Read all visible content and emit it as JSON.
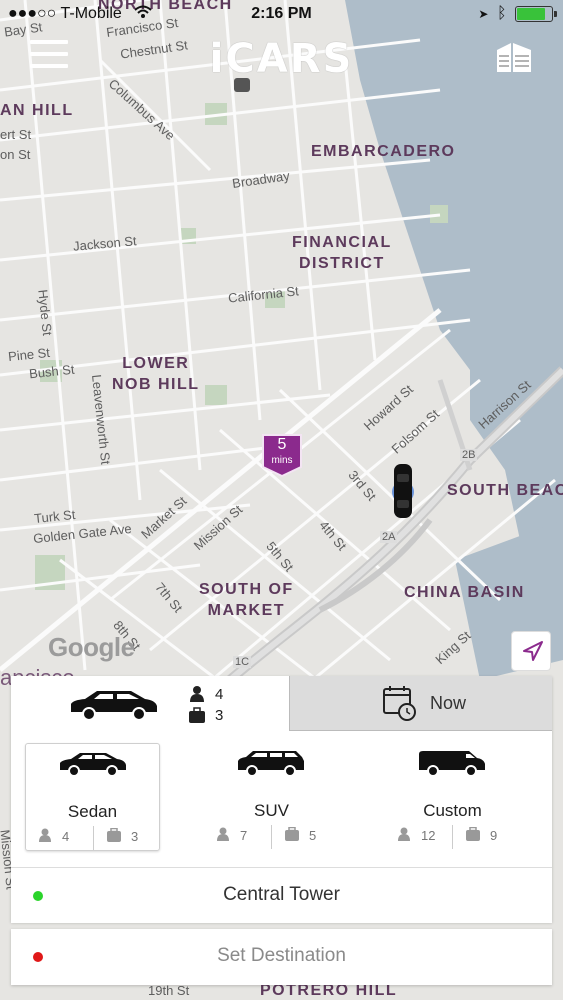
{
  "status_bar": {
    "carrier": "●●●○○ T-Mobile",
    "time": "2:16 PM",
    "battery_color": "#39c23a"
  },
  "header": {
    "logo": "iCARS",
    "menu_icon": "hamburger-icon",
    "building_icon": "building-icon"
  },
  "map": {
    "areas": {
      "north_beach": "NORTH BEACH",
      "russian_hill": "AN HILL",
      "embarcadero": "EMBARCADERO",
      "financial_district": "FINANCIAL\nDISTRICT",
      "lower_nob_hill": "LOWER\nNOB HILL",
      "south_beach": "SOUTH BEAC",
      "south_of_market": "SOUTH OF\nMARKET",
      "china_basin": "CHINA BASIN",
      "potrero_hill": "POTRERO HILL"
    },
    "streets": {
      "bay": "Bay St",
      "francisco": "Francisco St",
      "chestnut": "Chestnut St",
      "columbus": "Columbus Ave",
      "broadway": "Broadway",
      "jackson": "Jackson St",
      "california": "California St",
      "hyde": "Hyde St",
      "pine": "Pine St",
      "bush": "Bush St",
      "leavenworth": "Leavenworth St",
      "turk": "Turk St",
      "golden_gate": "Golden Gate Ave",
      "market": "Market St",
      "mission": "Mission St",
      "howard": "Howard St",
      "folsom": "Folsom St",
      "harrison": "Harrison St",
      "third": "3rd St",
      "fourth": "4th St",
      "fifth": "5th St",
      "seventh": "7th St",
      "eighth": "8th St",
      "king": "King St",
      "nineteenth": "19th St",
      "mission_left": "Mission St",
      "ert": "ert St",
      "on": "on St",
      "francisco_left": "ancisco"
    },
    "highway_labels": {
      "b2b": "2B",
      "b2a": "2A",
      "b1c": "1C"
    },
    "eta": {
      "value": "5",
      "unit": "mins"
    },
    "google": "Google"
  },
  "panel": {
    "tab_vehicle": {
      "passengers": "4",
      "luggage": "3"
    },
    "tab_time": {
      "label": "Now"
    },
    "vehicles": [
      {
        "name": "Sedan",
        "passengers": "4",
        "luggage": "3"
      },
      {
        "name": "SUV",
        "passengers": "7",
        "luggage": "5"
      },
      {
        "name": "Custom",
        "passengers": "12",
        "luggage": "9"
      }
    ]
  },
  "pickup": {
    "label": "Central Tower",
    "dot_color": "#2bd42b"
  },
  "destination": {
    "label": "Set Destination",
    "dot_color": "#e01818"
  }
}
